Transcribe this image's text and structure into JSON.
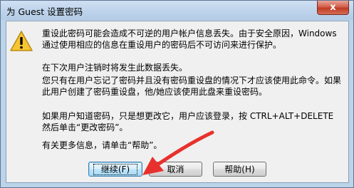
{
  "window": {
    "title": "为 Guest 设置密码",
    "close_glyph": "x"
  },
  "message": {
    "p1": "重设此密码可能会造成不可逆的用户帐户信息丢失。由于安全原因，Windows 通过使用相应的信息在重设用户的密码后不可访问来进行保护。",
    "p2": "在下次用户注销时将发生此数据丢失。",
    "p3": "您只有在用户忘记了密码并且没有密码重设盘的情况下才应该使用此命令。如果此用户创建了密码重设盘，他/她应该使用此盘来重设密码。",
    "p4": "如果用户知道密码，只是想更改它，用户应该登录，按 CTRL+ALT+DELETE 然后单击“更改密码”。",
    "p5": "有关更多信息，请单击“帮助”。"
  },
  "buttons": {
    "continue": "继续(F)",
    "cancel": "取消",
    "help": "帮助(H)"
  },
  "icons": {
    "warning": "warning-icon",
    "annotation": "red-arrow-annotation"
  },
  "colors": {
    "arrow": "#e8312c",
    "warning_fill": "#f7c531"
  }
}
